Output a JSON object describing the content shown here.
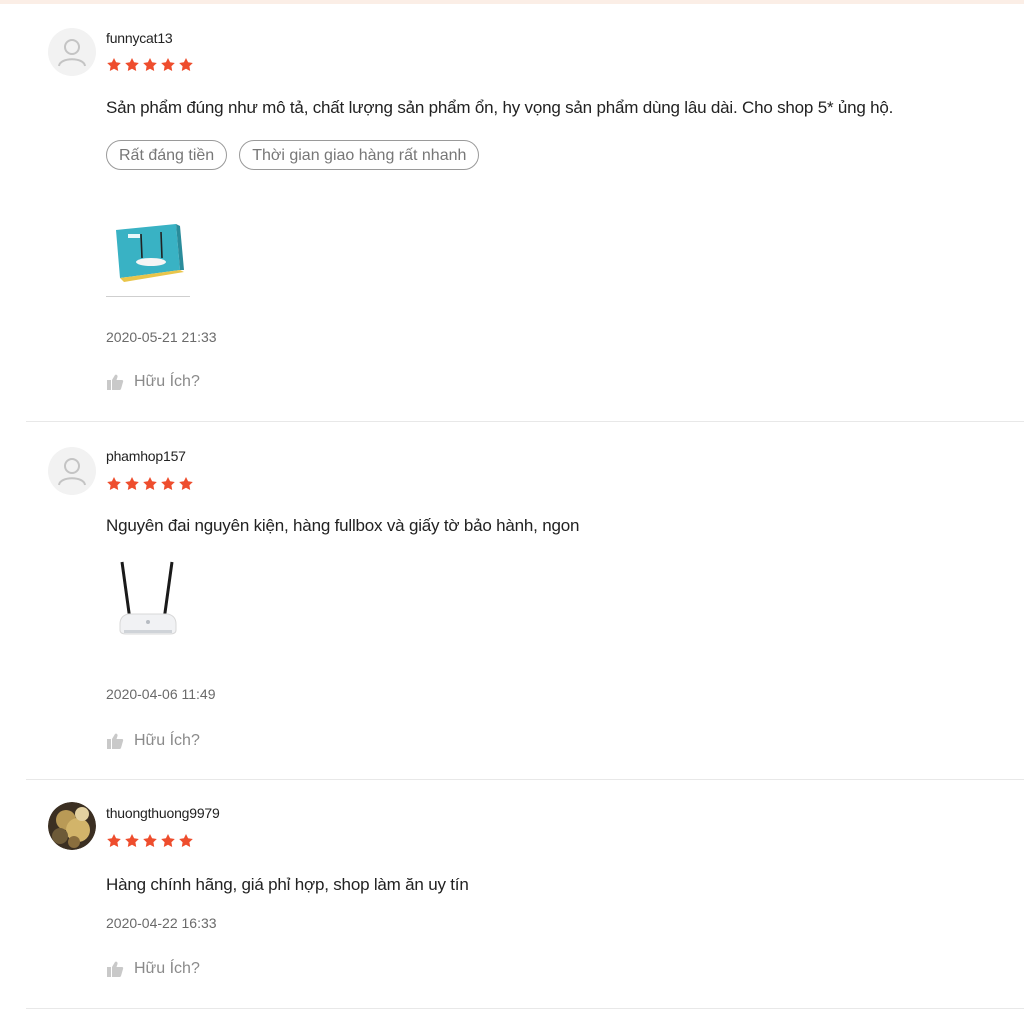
{
  "colors": {
    "star": "#ee4d2d",
    "tag_border": "#9a9a9a",
    "muted_text": "#8a8a8a"
  },
  "reviews": [
    {
      "username": "funnycat13",
      "rating": 5,
      "comment": "Sản phẩm đúng như mô tả, chất lượng sản phẩm ổn, hy vọng sản phẩm dùng lâu dài. Cho shop 5* ủng hộ.",
      "tags": [
        "Rất đáng tiền",
        "Thời gian giao hàng rất nhanh"
      ],
      "avatar": "default-user-icon",
      "image": "router-box-photo",
      "time": "2020-05-21 21:33",
      "helpful_label": "Hữu Ích?",
      "helpful_icon": "thumbs-up-icon"
    },
    {
      "username": "phamhop157",
      "rating": 5,
      "comment": "Nguyên đai nguyên kiện, hàng fullbox và giấy tờ bảo hành, ngon",
      "avatar": "default-user-icon",
      "image": "router-photo",
      "time": "2020-04-06 11:49",
      "helpful_label": "Hữu Ích?",
      "helpful_icon": "thumbs-up-icon"
    },
    {
      "username": "thuongthuong9979",
      "rating": 5,
      "comment": "Hàng chính hãng, giá phỉ hợp, shop làm ăn uy tín",
      "avatar": "user-photo-avatar",
      "time": "2020-04-22 16:33",
      "helpful_label": "Hữu Ích?",
      "helpful_icon": "thumbs-up-icon"
    }
  ]
}
